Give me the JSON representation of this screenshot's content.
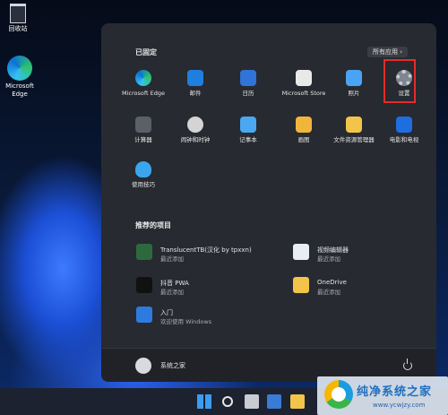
{
  "desktop": {
    "icons": [
      {
        "label": "回收站"
      },
      {
        "label": "Microsoft Edge"
      }
    ]
  },
  "start": {
    "pinned_title": "已固定",
    "all_apps_label": "所有应用  ›",
    "pinned": [
      {
        "label": "Microsoft Edge",
        "icon": "edge-icon",
        "color": "#1a8fe0"
      },
      {
        "label": "邮件",
        "icon": "mail-icon",
        "color": "#1e7fe0"
      },
      {
        "label": "日历",
        "icon": "calendar-icon",
        "color": "#2f74d6"
      },
      {
        "label": "Microsoft Store",
        "icon": "store-icon",
        "color": "#e9e9ea"
      },
      {
        "label": "照片",
        "icon": "photos-icon",
        "color": "#4aa3f5"
      },
      {
        "label": "设置",
        "icon": "gear-icon",
        "color": "#7f8591"
      },
      {
        "label": "计算器",
        "icon": "calculator-icon",
        "color": "#5a5f68"
      },
      {
        "label": "闹钟和时钟",
        "icon": "clock-icon",
        "color": "#d4d4d4"
      },
      {
        "label": "记事本",
        "icon": "notepad-icon",
        "color": "#4aa8f0"
      },
      {
        "label": "画图",
        "icon": "paint-icon",
        "color": "#f0b53a"
      },
      {
        "label": "文件资源管理器",
        "icon": "folder-icon",
        "color": "#f3c44a"
      },
      {
        "label": "电影和电视",
        "icon": "film-icon",
        "color": "#1e6ee0"
      },
      {
        "label": "使用技巧",
        "icon": "tips-icon",
        "color": "#3aa6f0"
      }
    ],
    "recommended_title": "推荐的项目",
    "recommended": [
      {
        "title": "TranslucentTB(汉化 by tpxxn)",
        "sub": "最近添加",
        "icon": "translucenttb-icon",
        "color": "#2c6a3e"
      },
      {
        "title": "视频编辑器",
        "sub": "最近添加",
        "icon": "video-editor-icon",
        "color": "#e9eef5"
      },
      {
        "title": "抖音 PWA",
        "sub": "最近添加",
        "icon": "douyin-icon",
        "color": "#111111"
      },
      {
        "title": "OneDrive",
        "sub": "最近添加",
        "icon": "onedrive-icon",
        "color": "#f3c44a"
      },
      {
        "title": "入门",
        "sub": "欢迎使用 Windows",
        "icon": "get-started-icon",
        "color": "#2d7be0"
      }
    ],
    "user_name": "系统之家"
  },
  "watermark": {
    "title": "纯净系统之家",
    "url": "www.ycwjzy.com"
  }
}
